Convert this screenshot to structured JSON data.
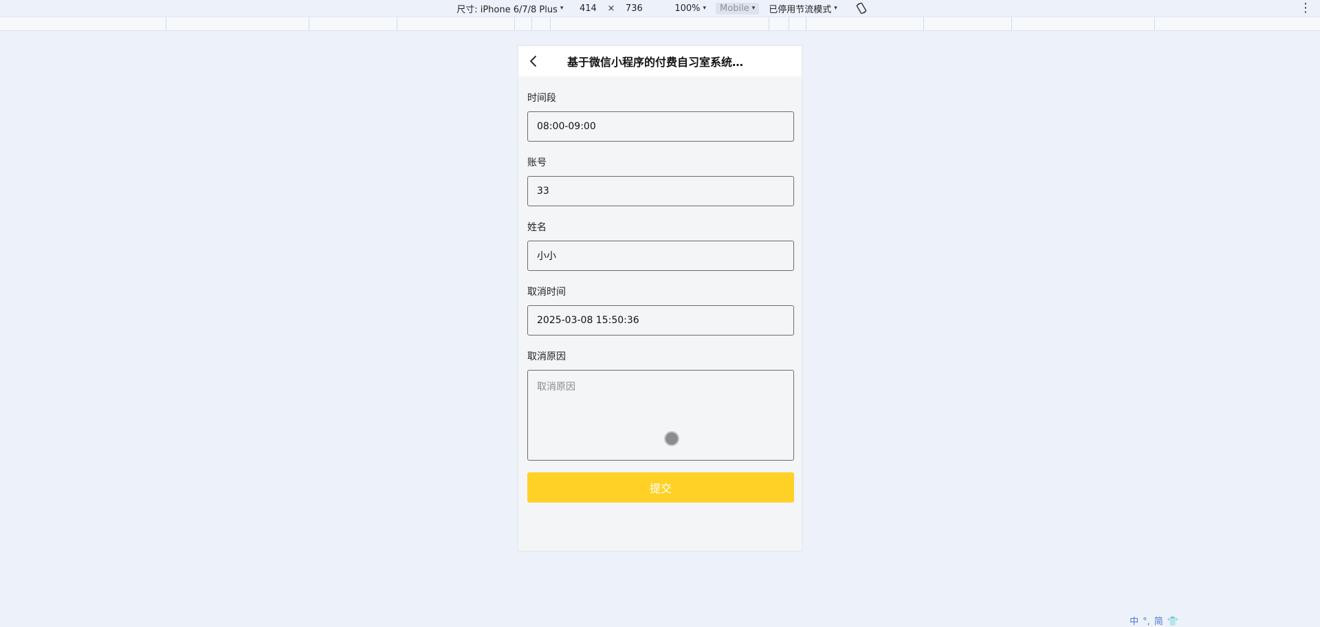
{
  "devtools": {
    "dimensions_label": "尺寸: iPhone 6/7/8 Plus",
    "width": "414",
    "times": "×",
    "height": "736",
    "zoom": "100%",
    "device_type": "Mobile",
    "throttle": "已停用节流模式",
    "caret": "▾",
    "more": "⋮"
  },
  "nav": {
    "title": "基于微信小程序的付费自习室系统设..."
  },
  "form": {
    "time_slot": {
      "label": "时间段",
      "value": "08:00-09:00"
    },
    "account": {
      "label": "账号",
      "value": "33"
    },
    "name": {
      "label": "姓名",
      "value": "小小"
    },
    "cancel_time": {
      "label": "取消时间",
      "value": "2025-03-08 15:50:36"
    },
    "cancel_reason": {
      "label": "取消原因",
      "placeholder": "取消原因"
    },
    "submit_label": "提交"
  },
  "ime": {
    "lang": "中",
    "punct": "°,",
    "mode": "简",
    "skin": "👕"
  },
  "colors": {
    "submit": "#ffd127",
    "page_bg": "#edf1f9"
  }
}
